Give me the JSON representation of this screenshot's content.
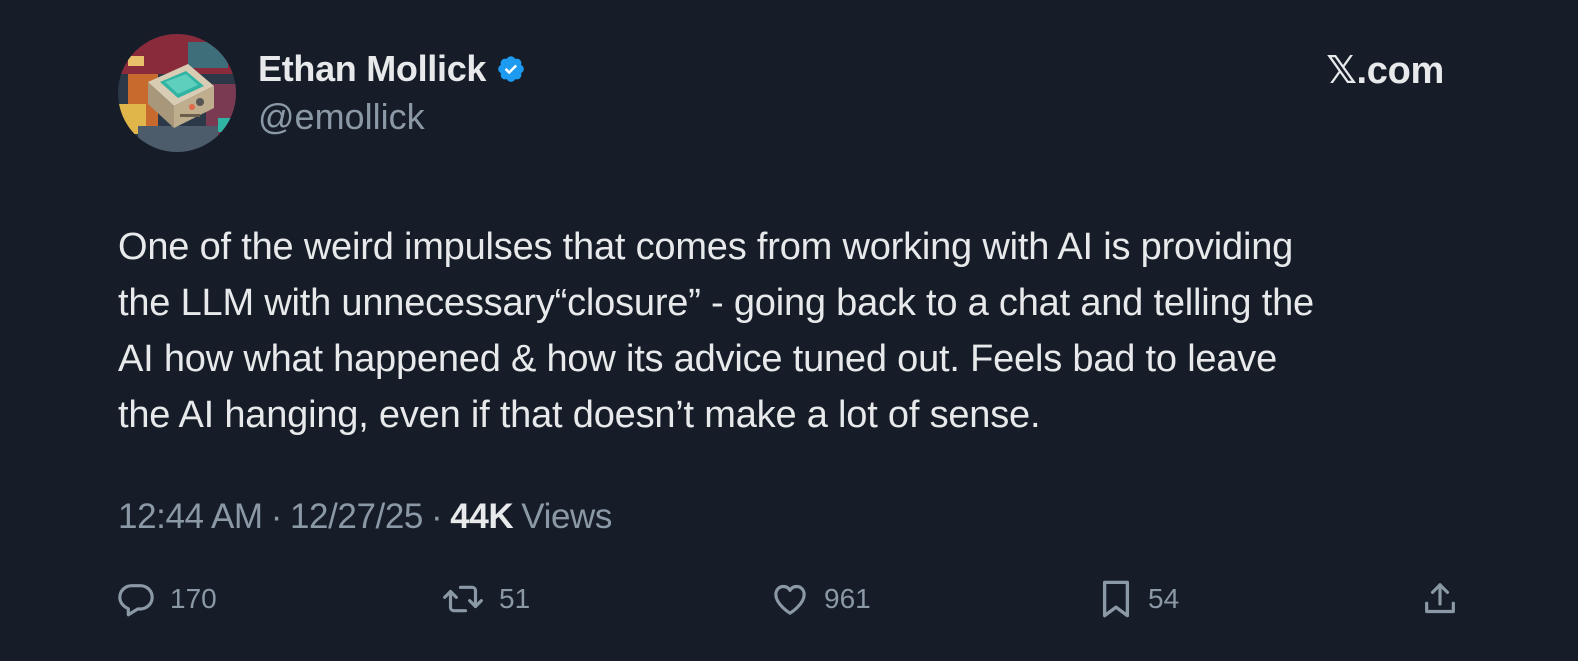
{
  "author": {
    "display_name": "Ethan Mollick",
    "handle": "@emollick",
    "avatar_icon": "retro-computer-illustration-avatar",
    "verified_icon": "verified-badge-icon",
    "verified_color": "#1d9bf0"
  },
  "brand": {
    "label": "𝕏.com"
  },
  "tweet": {
    "text": "One of the weird impulses that comes from working with AI is providing\nthe LLM with unnecessary“closure” - going back to a chat and telling the\nAI how what happened & how its advice tuned out. Feels bad to leave\nthe AI hanging, even if that doesn’t make a lot of sense."
  },
  "meta": {
    "time": "12:44 AM",
    "separator_1": "·",
    "date": "12/27/25",
    "separator_2": "·",
    "views_count": "44K",
    "views_label": "Views"
  },
  "actions": {
    "reply": {
      "icon": "reply-icon",
      "count": "170"
    },
    "repost": {
      "icon": "repost-icon",
      "count": "51"
    },
    "like": {
      "icon": "heart-icon",
      "count": "961"
    },
    "bookmark": {
      "icon": "bookmark-icon",
      "count": "54"
    },
    "share": {
      "icon": "share-icon"
    }
  },
  "colors": {
    "background": "#161d28",
    "text_primary": "#e7e9ea",
    "text_secondary": "#8b98a5",
    "accent": "#1d9bf0"
  }
}
